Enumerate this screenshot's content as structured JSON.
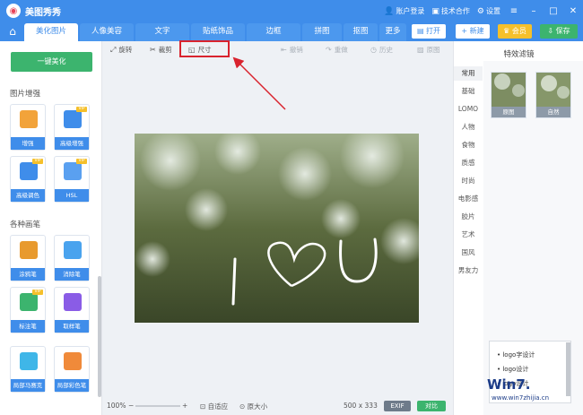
{
  "titlebar": {
    "title": "美图秀秀",
    "login": "账户登录",
    "partner": "技术合作",
    "settings": "设置"
  },
  "tabs": [
    "美化图片",
    "人像美容",
    "文字",
    "贴纸饰品",
    "边框",
    "拼图",
    "抠图",
    "更多"
  ],
  "actions": {
    "open": "打开",
    "new": "新建",
    "vip": "会员",
    "save": "保存"
  },
  "edit_tools": {
    "rotate": "旋转",
    "crop": "裁剪",
    "size": "尺寸",
    "undo": "撤销",
    "redo": "重做",
    "history": "历史",
    "original": "原图"
  },
  "sidebar": {
    "one_click": "一键美化",
    "enhance_title": "图片增强",
    "brush_title": "各种画笔",
    "tools": [
      {
        "label": "增强",
        "icon": "sliders-icon",
        "color": "#f2a33a",
        "vip": false
      },
      {
        "label": "高级增强",
        "icon": "magic-wand-icon",
        "color": "#3f8dea",
        "vip": true
      },
      {
        "label": "高级调色",
        "icon": "palette-icon",
        "color": "#3f8dea",
        "vip": true
      },
      {
        "label": "HSL",
        "icon": "sliders-icon",
        "color": "#5aa0f0",
        "vip": true
      },
      {
        "label": "涂鸦笔",
        "icon": "brush-icon",
        "color": "#e89a2e",
        "vip": false
      },
      {
        "label": "消除笔",
        "icon": "eraser-icon",
        "color": "#4aa3ee",
        "vip": false
      },
      {
        "label": "标注笔",
        "icon": "marker-icon",
        "color": "#3cb46e",
        "vip": true
      },
      {
        "label": "取样笔",
        "icon": "dropper-icon",
        "color": "#8a5ce6",
        "vip": false
      },
      {
        "label": "局部马赛克",
        "icon": "mosaic-icon",
        "color": "#3fb6e8",
        "vip": false
      },
      {
        "label": "局部彩色笔",
        "icon": "color-brush-icon",
        "color": "#f08a3a",
        "vip": false
      }
    ],
    "vip_label": "VIP"
  },
  "canvas": {
    "caption": ""
  },
  "bottombar": {
    "zoom": "100%",
    "fit": "自适应",
    "actual": "原大小",
    "dims": "500 x 333",
    "exif": "EXIF",
    "compare": "对比"
  },
  "right_panel": {
    "title": "特效滤镜",
    "categories": [
      "常用",
      "基础",
      "LOMO",
      "人物",
      "食物",
      "质感",
      "时尚",
      "电影感",
      "胶片",
      "艺术",
      "国风",
      "男友力"
    ],
    "thumbs": [
      "原图",
      "自然"
    ],
    "popup": [
      "logo字设计",
      "logo设计",
      "logo设计"
    ]
  },
  "watermark": {
    "text": "Win7.",
    "site": "www.win7zhijia.cn"
  }
}
